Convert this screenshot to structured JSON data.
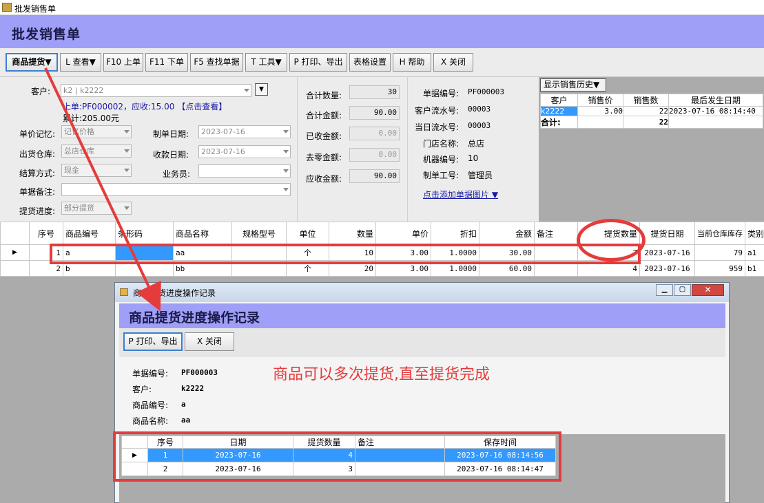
{
  "window": {
    "title": "批发销售单"
  },
  "header": {
    "title": "批发销售单"
  },
  "toolbar": {
    "items": [
      "商品提货▼",
      "L 查看▼",
      "F10 上单",
      "F11 下单",
      "F5 查找单据",
      "T 工具▼",
      "P 打印、导出",
      "表格设置",
      "H 帮助",
      "X 关闭"
    ]
  },
  "form": {
    "customer_label": "客户:",
    "customer_value": "k2 | k2222",
    "prev_order": "上单:PF000002，应收:15.00",
    "prev_link": "【点击查看】",
    "cumulative": "累计:205.00元",
    "price_memory_label": "单价记忆:",
    "price_memory_value": "记忆价格",
    "make_date_label": "制单日期:",
    "make_date_value": "2023-07-16",
    "warehouse_label": "出货仓库:",
    "warehouse_value": "总店仓库",
    "receive_date_label": "收款日期:",
    "receive_date_value": "2023-07-16",
    "settle_label": "结算方式:",
    "settle_value": "现金",
    "salesman_label": "业务员:",
    "remark_label": "单据备注:",
    "progress_label": "提货进度:",
    "progress_value": "部分提货"
  },
  "totals": {
    "qty_label": "合计数量:",
    "qty_value": "30",
    "amount_label": "合计金额:",
    "amount_value": "90.00",
    "received_label": "已收金额:",
    "received_value": "0.00",
    "rounding_label": "去零金额:",
    "rounding_value": "0.00",
    "receivable_label": "应收金额:",
    "receivable_value": "90.00"
  },
  "docinfo": {
    "doc_no_label": "单据编号:",
    "doc_no_value": "PF000003",
    "cust_serial_label": "客户流水号:",
    "cust_serial_value": "00003",
    "day_serial_label": "当日流水号:",
    "day_serial_value": "00003",
    "store_label": "门店名称:",
    "store_value": "总店",
    "machine_label": "机器编号:",
    "machine_value": "10",
    "operator_label": "制单工号:",
    "operator_value": "管理员",
    "add_image_link": "点击添加单据图片 ▼"
  },
  "history": {
    "button": "显示销售历史▼",
    "headers": [
      "客户",
      "销售价",
      "销售数",
      "最后发生日期"
    ],
    "row": [
      "k2222",
      "3.00",
      "22",
      "2023-07-16 08:14:40"
    ],
    "total": [
      "合计:",
      "",
      "22",
      ""
    ]
  },
  "main_grid": {
    "headers": [
      "序号",
      "商品编号",
      "条形码",
      "商品名称",
      "规格型号",
      "单位",
      "数量",
      "单价",
      "折扣",
      "金额",
      "备注",
      "提货数量",
      "提货日期",
      "当前仓库库存",
      "类别"
    ],
    "rows": [
      [
        "1",
        "a",
        "",
        "aa",
        "",
        "个",
        "10",
        "3.00",
        "1.0000",
        "30.00",
        "",
        "7",
        "2023-07-16",
        "79",
        "a1"
      ],
      [
        "2",
        "b",
        "",
        "bb",
        "",
        "个",
        "20",
        "3.00",
        "1.0000",
        "60.00",
        "",
        "4",
        "2023-07-16",
        "959",
        "b1"
      ]
    ]
  },
  "dialog": {
    "window_title": "商品提货进度操作记录",
    "title": "商品提货进度操作记录",
    "print_button": "P 打印、导出",
    "close_button": "X 关闭",
    "doc_no_label": "单据编号:",
    "doc_no_value": "PF000003",
    "customer_label": "客户:",
    "customer_value": "k2222",
    "item_code_label": "商品编号:",
    "item_code_value": "a",
    "item_name_label": "商品名称:",
    "item_name_value": "aa",
    "annotation": "商品可以多次提货,直至提货完成",
    "grid_headers": [
      "序号",
      "日期",
      "提货数量",
      "备注",
      "保存时间"
    ],
    "grid_rows": [
      [
        "1",
        "2023-07-16",
        "4",
        "",
        "2023-07-16 08:14:56"
      ],
      [
        "2",
        "2023-07-16",
        "3",
        "",
        "2023-07-16 08:14:47"
      ]
    ]
  },
  "colors": {
    "header_bg": "#9f9ff7",
    "annotation_red": "#e53b3b",
    "selection": "#3399ff",
    "link": "#1a1aa8"
  }
}
